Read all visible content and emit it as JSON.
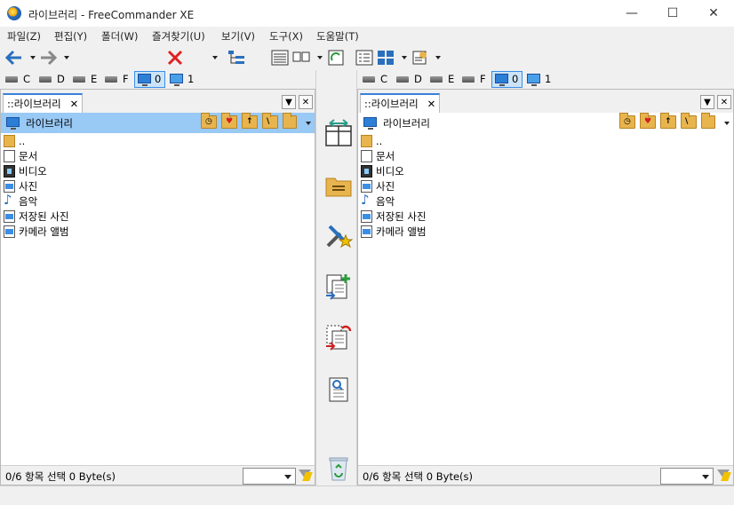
{
  "window": {
    "title": "라이브러리 - FreeCommander XE",
    "minimize": "—",
    "maximize": "☐",
    "close": "✕"
  },
  "menu": [
    "파일(Z)",
    "편집(Y)",
    "폴더(W)",
    "즐겨찾기(U)",
    "보기(V)",
    "도구(X)",
    "도움말(T)"
  ],
  "drives": [
    "C",
    "D",
    "E",
    "F",
    "0",
    "1"
  ],
  "left": {
    "tab": "::라이브러리",
    "path": "라이브러리",
    "files": [
      {
        "name": "..",
        "icon": "folder-up-icon"
      },
      {
        "name": "문서",
        "icon": "document-icon"
      },
      {
        "name": "비디오",
        "icon": "video-icon"
      },
      {
        "name": "사진",
        "icon": "picture-icon"
      },
      {
        "name": "음악",
        "icon": "music-icon"
      },
      {
        "name": "저장된 사진",
        "icon": "picture-icon"
      },
      {
        "name": "카메라 앨범",
        "icon": "picture-icon"
      }
    ],
    "status": "0/6 항목 선택    0 Byte(s)"
  },
  "right": {
    "tab": "::라이브러리",
    "path": "라이브러리",
    "files": [
      {
        "name": "..",
        "icon": "folder-up-icon"
      },
      {
        "name": "문서",
        "icon": "document-icon"
      },
      {
        "name": "비디오",
        "icon": "video-icon"
      },
      {
        "name": "사진",
        "icon": "picture-icon"
      },
      {
        "name": "음악",
        "icon": "music-icon"
      },
      {
        "name": "저장된 사진",
        "icon": "picture-icon"
      },
      {
        "name": "카메라 앨범",
        "icon": "picture-icon"
      }
    ],
    "status": "0/6 항목 선택    0 Byte(s)"
  },
  "colors": {
    "accent": "#3b7fd9",
    "selected_path": "#99c9f5",
    "folder": "#e8b44e",
    "delete": "#e02020"
  }
}
